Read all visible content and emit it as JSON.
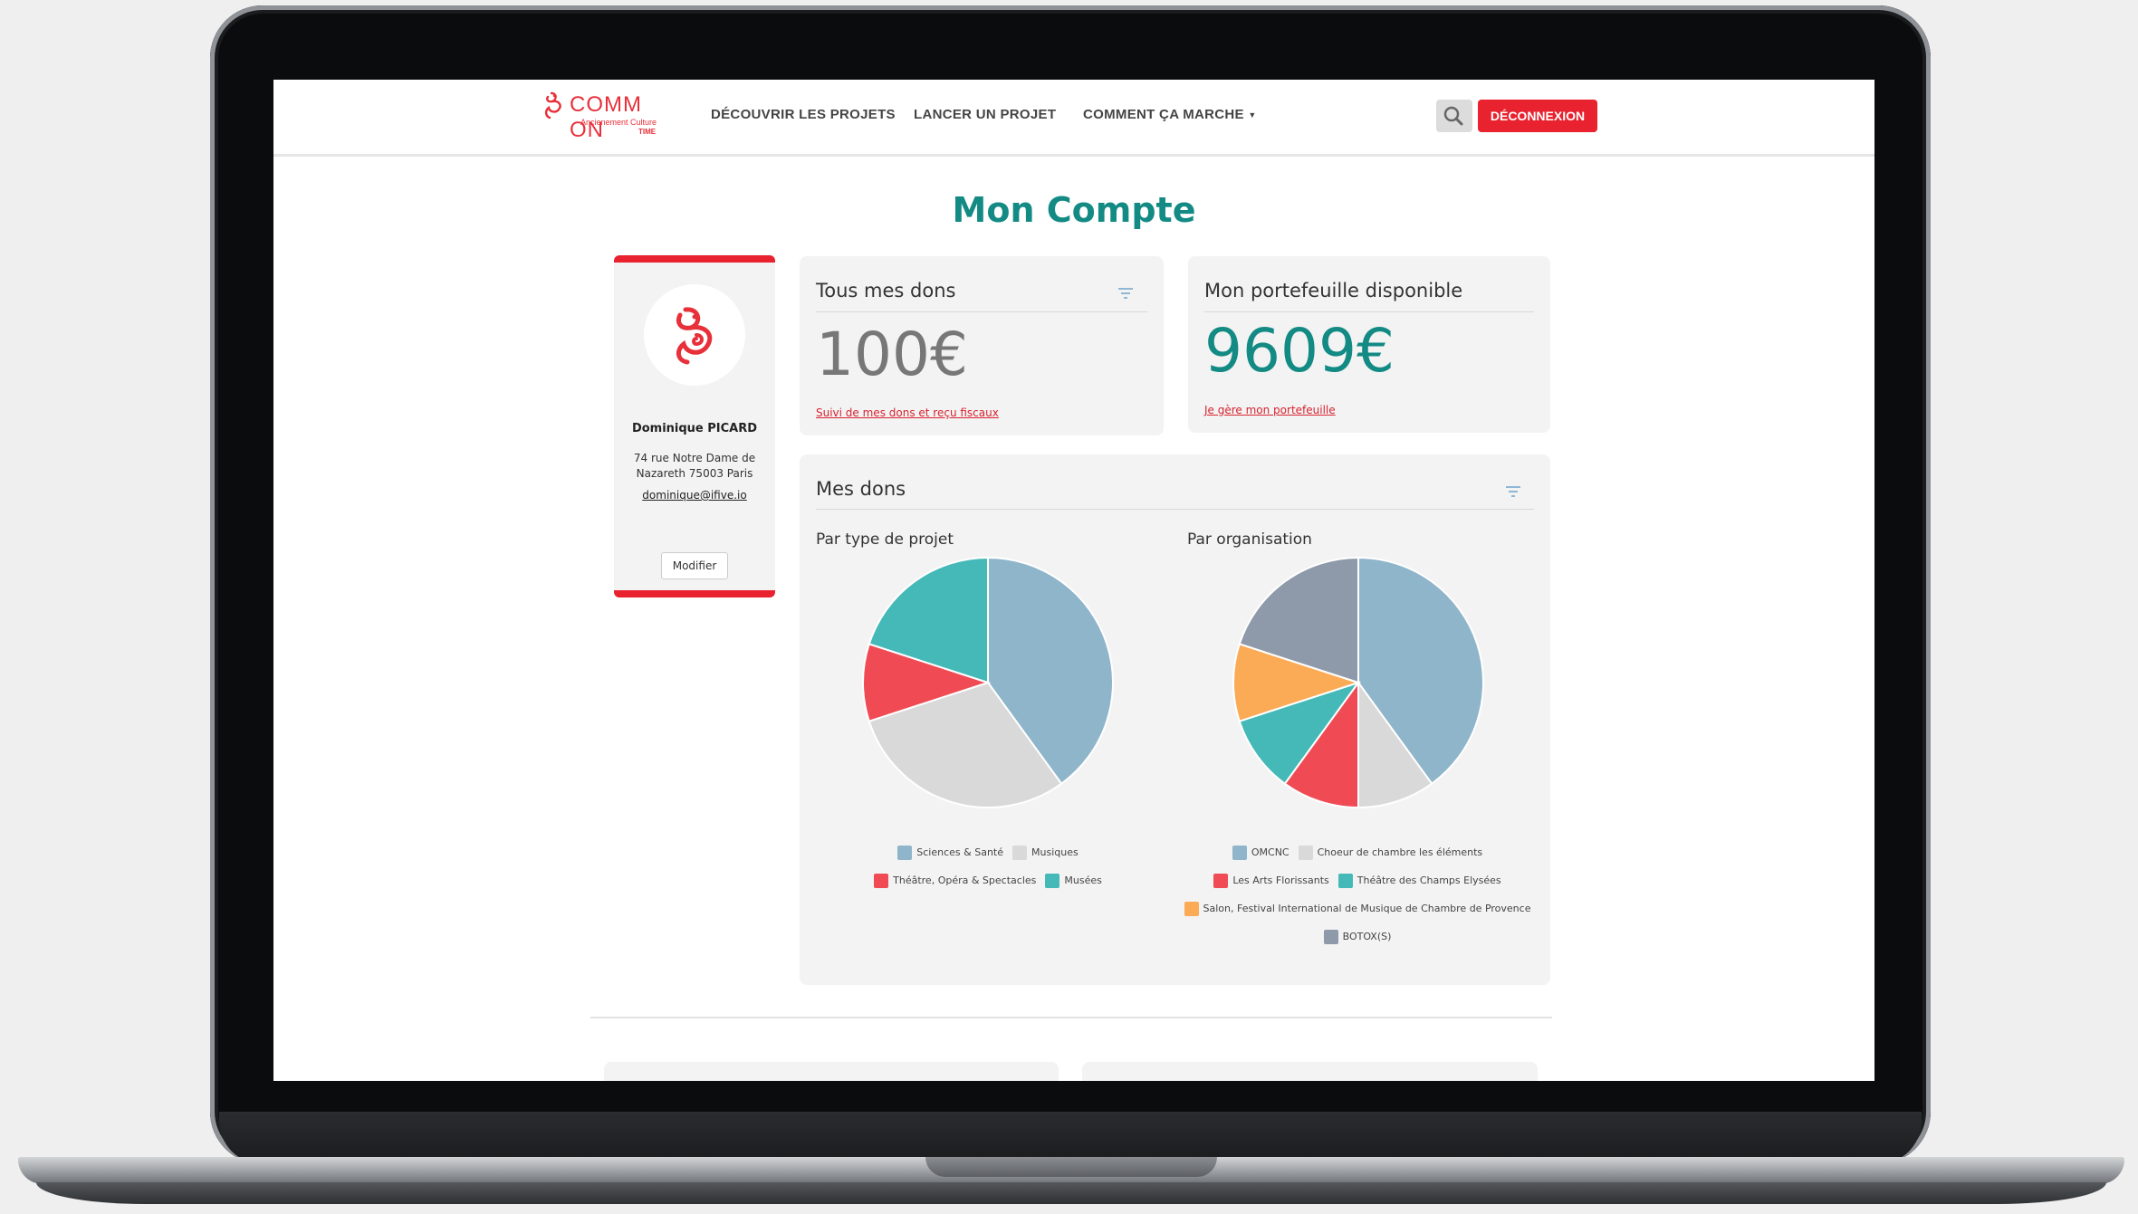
{
  "navbar": {
    "logo_word": "COMM ON",
    "logo_tagline": "Ancienement Culture",
    "logo_time": "TIME",
    "links": [
      "DÉCOUVRIR LES PROJETS",
      "LANCER UN PROJET",
      "COMMENT ÇA MARCHE"
    ],
    "logout_label": "DÉCONNEXION",
    "search_icon": "search-icon",
    "dropdown_icon": "caret-down-icon"
  },
  "page": {
    "title": "Mon Compte"
  },
  "profile": {
    "name": "Dominique PICARD",
    "address": "74 rue Notre Dame de Nazareth 75003 Paris",
    "email": "dominique@ifive.io",
    "modify_label": "Modifier"
  },
  "donations_total": {
    "title": "Tous mes dons",
    "amount": "100€",
    "link": "Suivi de mes dons et reçu fiscaux"
  },
  "wallet": {
    "title": "Mon portefeuille disponible",
    "amount": "9609€",
    "link": "Je gère mon portefeuille"
  },
  "my_donations": {
    "title": "Mes dons",
    "by_type_label": "Par type de projet",
    "by_org_label": "Par organisation"
  },
  "colors": {
    "accent_red": "#e8222f",
    "title_teal": "#138a84"
  },
  "chart_data": [
    {
      "type": "pie",
      "title": "Par type de projet",
      "labels": [
        "Sciences & Santé",
        "Musiques",
        "Théâtre, Opéra & Spectacles",
        "Musées"
      ],
      "values": [
        40,
        30,
        10,
        20
      ],
      "colors": [
        "#8fb5ca",
        "#d9d9d9",
        "#f04b55",
        "#45b8b8"
      ]
    },
    {
      "type": "pie",
      "title": "Par organisation",
      "labels": [
        "OMCNC",
        "Choeur de chambre les éléments",
        "Les Arts Florissants",
        "Théâtre des Champs Elysées",
        "Salon, Festival International de Musique de Chambre de Provence",
        "BOTOX(S)"
      ],
      "values": [
        40,
        10,
        10,
        10,
        10,
        20
      ],
      "colors": [
        "#8fb5ca",
        "#d9d9d9",
        "#f04b55",
        "#45b8b8",
        "#fbaa55",
        "#8e9aaa"
      ]
    }
  ]
}
